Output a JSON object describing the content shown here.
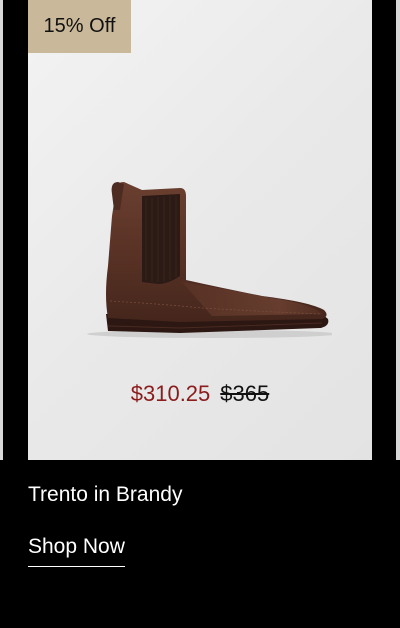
{
  "product": {
    "discount_badge": "15% Off",
    "sale_price": "$310.25",
    "original_price": "$365",
    "title": "Trento in Brandy",
    "cta_label": "Shop Now",
    "image_icon": "chelsea-boot-image"
  },
  "colors": {
    "background": "#000000",
    "badge": "#c9b99a",
    "sale_price": "#8b1c1c",
    "card": "#ececec"
  }
}
